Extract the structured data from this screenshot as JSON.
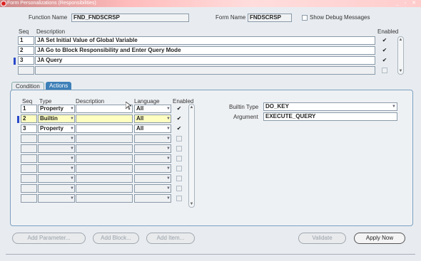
{
  "window": {
    "title": "Form Personalizations (Responsibilities)"
  },
  "header": {
    "function_name_label": "Function Name",
    "function_name_value": "FND_FNDSCRSP",
    "form_name_label": "Form Name",
    "form_name_value": "FNDSCRSP",
    "debug_label": "Show Debug Messages"
  },
  "rules": {
    "seq_header": "Seq",
    "desc_header": "Description",
    "enabled_header": "Enabled",
    "rows": [
      {
        "seq": "1",
        "description": "JA Set Initial Value of Global Variable",
        "enabled": "✔"
      },
      {
        "seq": "2",
        "description": "JA Go to Block Responsibility and Enter Query Mode",
        "enabled": "✔"
      },
      {
        "seq": "3",
        "description": "JA Query",
        "enabled": "✔"
      },
      {
        "seq": "",
        "description": "",
        "enabled": ""
      }
    ]
  },
  "tabs": {
    "condition": "Condition",
    "actions": "Actions"
  },
  "actions": {
    "seq_header": "Seq",
    "type_header": "Type",
    "desc_header": "Description",
    "lang_header": "Language",
    "enabled_header": "Enabled",
    "rows": [
      {
        "seq": "1",
        "type": "Property",
        "description": "",
        "language": "All",
        "enabled": "✔"
      },
      {
        "seq": "2",
        "type": "Builtin",
        "description": "",
        "language": "All",
        "enabled": "✔"
      },
      {
        "seq": "3",
        "type": "Property",
        "description": "",
        "language": "All",
        "enabled": "✔"
      },
      {
        "seq": "",
        "type": "",
        "description": "",
        "language": "",
        "enabled": ""
      },
      {
        "seq": "",
        "type": "",
        "description": "",
        "language": "",
        "enabled": ""
      },
      {
        "seq": "",
        "type": "",
        "description": "",
        "language": "",
        "enabled": ""
      },
      {
        "seq": "",
        "type": "",
        "description": "",
        "language": "",
        "enabled": ""
      },
      {
        "seq": "",
        "type": "",
        "description": "",
        "language": "",
        "enabled": ""
      },
      {
        "seq": "",
        "type": "",
        "description": "",
        "language": "",
        "enabled": ""
      },
      {
        "seq": "",
        "type": "",
        "description": "",
        "language": "",
        "enabled": ""
      }
    ]
  },
  "detail": {
    "builtin_type_label": "Builtin Type",
    "builtin_type_value": "DO_KEY",
    "argument_label": "Argument",
    "argument_value": "EXECUTE_QUERY"
  },
  "buttons": {
    "add_parameter": "Add Parameter...",
    "add_block": "Add Block...",
    "add_item": "Add Item...",
    "validate": "Validate",
    "apply_now": "Apply Now"
  }
}
